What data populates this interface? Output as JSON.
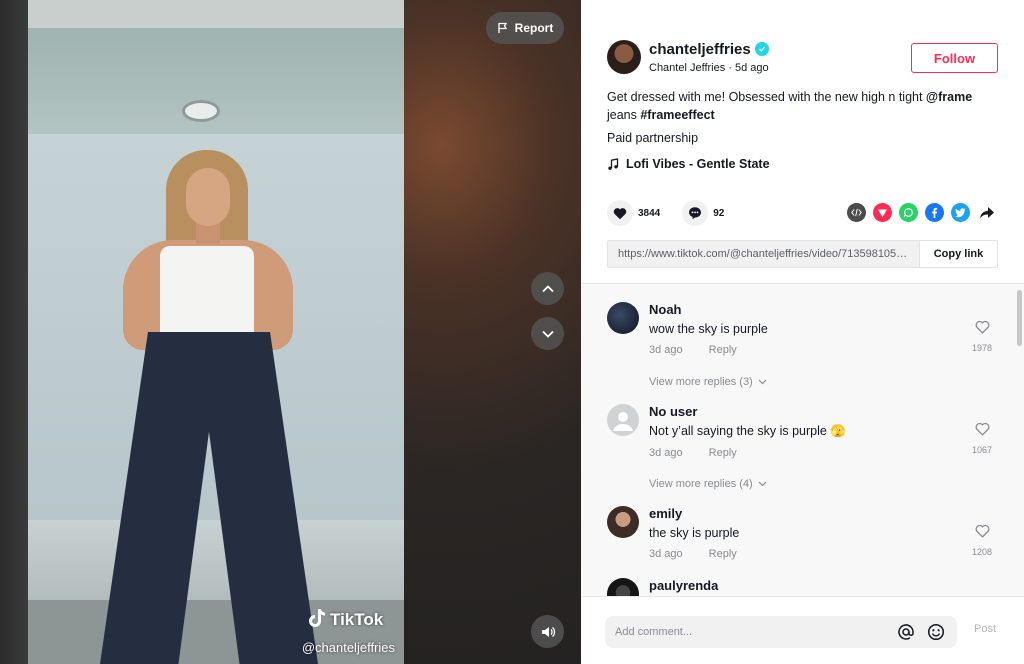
{
  "video": {
    "report_label": "Report",
    "watermark_brand": "TikTok",
    "watermark_handle": "@chanteljeffries"
  },
  "author": {
    "username": "chanteljeffries",
    "nickname": "Chantel Jeffries",
    "posted": "5d ago",
    "follow_label": "Follow"
  },
  "caption": {
    "text_before": "Get dressed with me! Obsessed with the new high n tight ",
    "mention": "@frame",
    "text_middle": " jeans ",
    "hashtag": "#frameeffect"
  },
  "paid_label": "Paid partnership",
  "music": "Lofi Vibes - Gentle State",
  "stats": {
    "likes": "3844",
    "comments": "92"
  },
  "share": {
    "link": "https://www.tiktok.com/@chanteljeffries/video/7135981057...",
    "copy_label": "Copy link"
  },
  "colors": {
    "accent": "#fe2c55",
    "verified": "#20d5ec",
    "embed": "#4b4b4b",
    "telegram": "#fe2c55",
    "whatsapp": "#25d366",
    "facebook": "#1877f2",
    "twitter": "#1da1f2"
  },
  "comments": [
    {
      "user": "Noah",
      "text": "wow the sky is purple",
      "time": "3d ago",
      "reply": "Reply",
      "likes": "1978",
      "view_more": "View more replies (3)"
    },
    {
      "user": "No user",
      "text": "Not y’all saying the sky is purple 🫣",
      "time": "3d ago",
      "reply": "Reply",
      "likes": "1067",
      "view_more": "View more replies (4)"
    },
    {
      "user": "emily",
      "text": "the sky is purple",
      "time": "3d ago",
      "reply": "Reply",
      "likes": "1208"
    },
    {
      "user": "paulyrenda"
    }
  ],
  "composer": {
    "placeholder": "Add comment...",
    "post_label": "Post"
  }
}
